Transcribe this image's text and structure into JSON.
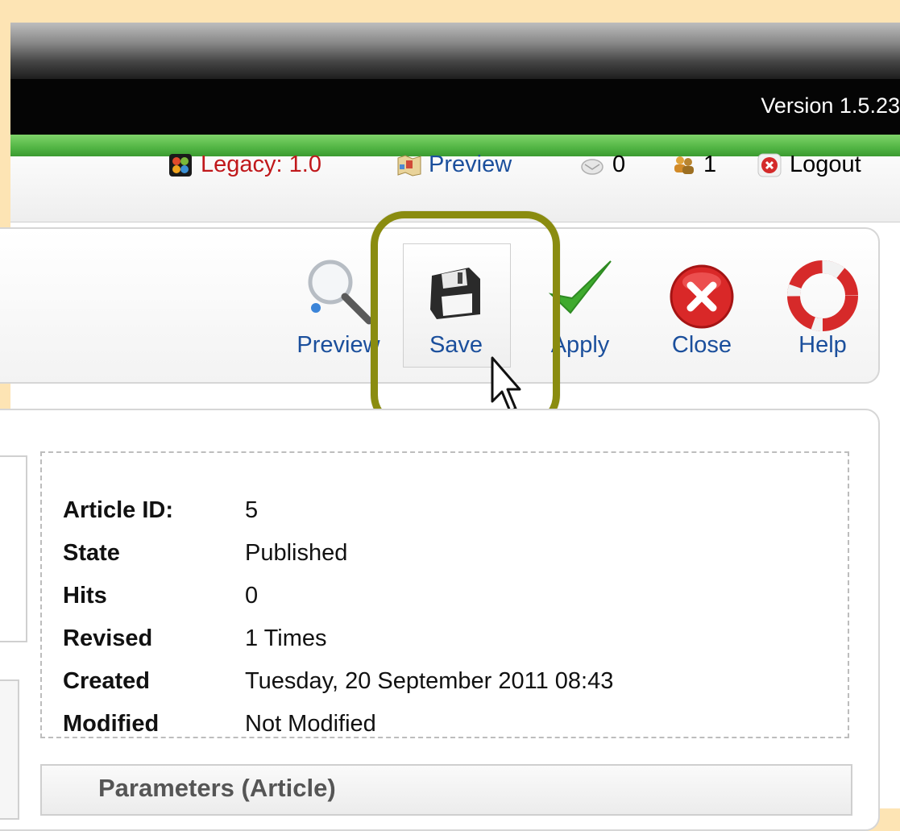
{
  "header": {
    "version": "Version 1.5.23"
  },
  "status": {
    "legacy": "Legacy: 1.0",
    "preview": "Preview",
    "messages": "0",
    "users": "1",
    "logout": "Logout"
  },
  "toolbar": {
    "preview": "Preview",
    "save": "Save",
    "apply": "Apply",
    "close": "Close",
    "help": "Help"
  },
  "details": {
    "rows": [
      {
        "key": "Article ID:",
        "value": "5"
      },
      {
        "key": "State",
        "value": "Published"
      },
      {
        "key": "Hits",
        "value": "0"
      },
      {
        "key": "Revised",
        "value": "1 Times"
      },
      {
        "key": "Created",
        "value": "Tuesday, 20 September 2011 08:43"
      },
      {
        "key": "Modified",
        "value": "Not Modified"
      }
    ]
  },
  "parameters": {
    "title": "Parameters (Article)"
  },
  "colors": {
    "link": "#1b4f9c",
    "legacy": "#c0181b",
    "highlight": "#8a8c10",
    "green_bar": "#52b544"
  },
  "icons": [
    "joomla-legacy-icon",
    "preview-map-icon",
    "messages-icon",
    "users-icon",
    "logout-icon",
    "magnifier-icon",
    "floppy-disk-icon",
    "checkmark-icon",
    "close-circle-icon",
    "lifebuoy-icon",
    "mouse-pointer-icon"
  ]
}
